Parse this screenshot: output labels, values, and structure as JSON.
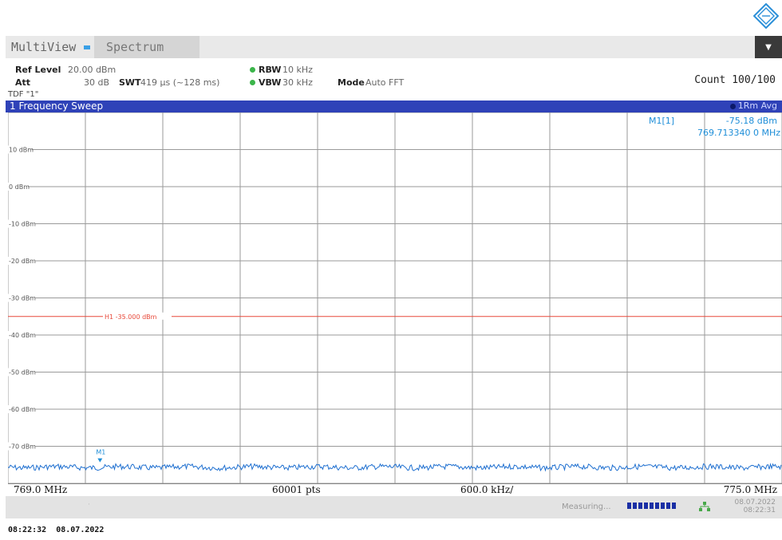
{
  "header": {
    "tabs": [
      {
        "label": "MultiView"
      },
      {
        "label": "Spectrum"
      }
    ],
    "menu_icon": "chevron-down-icon"
  },
  "settings": {
    "ref_level_label": "Ref Level",
    "ref_level_value": "20.00 dBm",
    "att_label": "Att",
    "att_value": "30 dB",
    "swt_label": "SWT",
    "swt_value": "419 µs (~128 ms)",
    "rbw_label": "RBW",
    "rbw_value": "10 kHz",
    "vbw_label": "VBW",
    "vbw_value": "30 kHz",
    "mode_label": "Mode",
    "mode_value": "Auto FFT",
    "count": "Count 100/100",
    "tdf": "TDF \"1\""
  },
  "window": {
    "title": "1 Frequency Sweep",
    "trace_label": "1Rm Avg"
  },
  "marker": {
    "name": "M1[1]",
    "level": "-75.18 dBm",
    "freq": "769.713340 0 MHz",
    "plot_label": "M1"
  },
  "limit_line": {
    "label": "H1 -35.000 dBm",
    "color": "#e8493a",
    "level_dbm": -35
  },
  "chart_data": {
    "type": "line",
    "yticks": [
      "10 dBm",
      "0 dBm",
      "-10 dBm",
      "-20 dBm",
      "-30 dBm",
      "-40 dBm",
      "-50 dBm",
      "-60 dBm",
      "-70 dBm"
    ],
    "ylim": [
      -80,
      20
    ],
    "xlim": [
      769.0,
      775.0
    ],
    "noise_floor_dbm": -75,
    "marker_x_mhz": 769.71334,
    "marker_y_dbm": -75.18,
    "trace_color": "#1e6fd0"
  },
  "axis": {
    "start": "769.0 MHz",
    "points": "60001 pts",
    "span_per_div": "600.0 kHz/",
    "stop": "775.0 MHz"
  },
  "status": {
    "text": "Measuring...",
    "date": "08.07.2022",
    "time": "08:22:31",
    "footer_time": "08:22:32",
    "footer_date": "08.07.2022",
    "accent": "#1a2fa5"
  }
}
